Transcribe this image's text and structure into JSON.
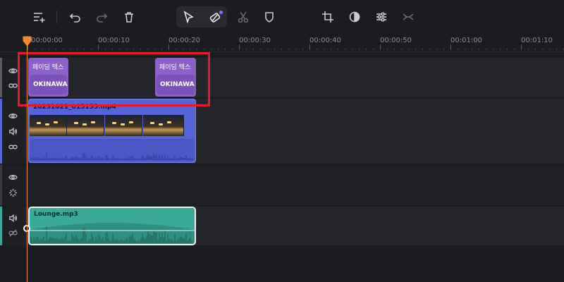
{
  "toolbar": {
    "icons": [
      "add-track-icon",
      "undo-icon",
      "redo-icon",
      "delete-icon",
      "select-pointer-icon",
      "ripple-edit-icon",
      "split-icon",
      "shield-icon",
      "crop-icon",
      "color-icon",
      "adjust-icon",
      "merge-icon"
    ]
  },
  "ruler": {
    "labels": [
      "00:00:00",
      "00:00:10",
      "00:00:20",
      "00:00:30",
      "00:00:40",
      "00:00:50",
      "00:01:00",
      "00:01:10"
    ]
  },
  "text_clips": [
    {
      "title": "페이딩 텍스",
      "subtitle": "OKINAWA"
    },
    {
      "title": "페이딩 텍스",
      "subtitle": "OKINAWA"
    }
  ],
  "video_clip": {
    "title": "20231021_015155.mp4"
  },
  "audio_clip": {
    "title": "Lounge.mp3"
  },
  "colors": {
    "accent": "#8a6bff",
    "text_clip": "#8c62c8",
    "video_clip": "#5564d8",
    "audio_clip": "#3aa99a",
    "playhead": "#f08a2a",
    "highlight": "#e8192c"
  }
}
